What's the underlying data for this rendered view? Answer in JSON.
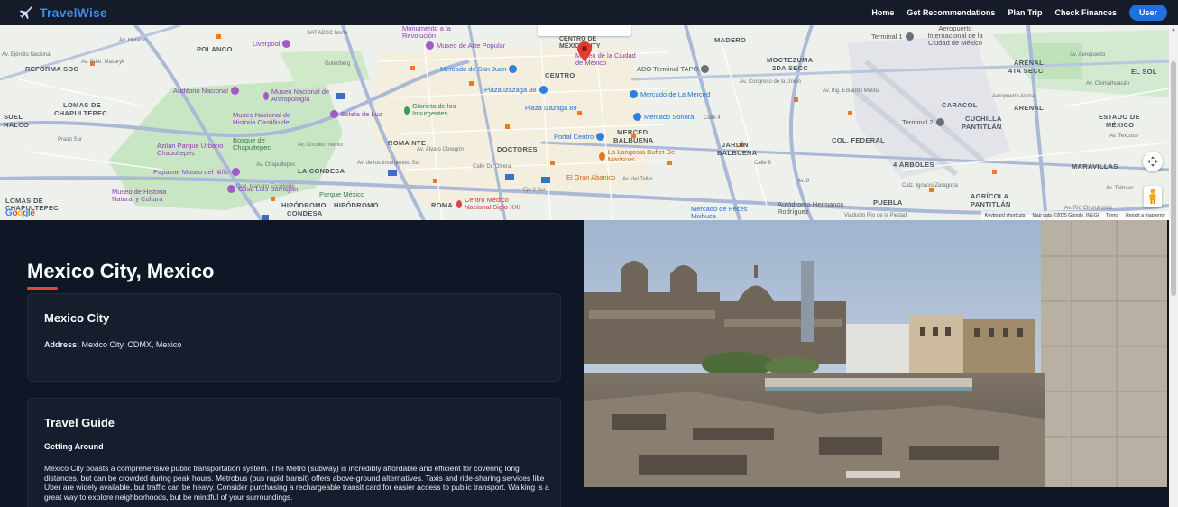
{
  "app": {
    "name": "TravelWise",
    "accent": "#3b8cf5"
  },
  "nav": {
    "links": [
      "Home",
      "Get Recommendations",
      "Plan Trip",
      "Check Finances"
    ],
    "user_label": "User"
  },
  "map": {
    "districts": [
      "POLANCO",
      "REFORMA SOC",
      "LOMAS DE",
      "CHAPULTEPEC",
      "ROMA NTE",
      "DOCTORES",
      "LA CONDESA",
      "HIPÓDROMO",
      "CONDESA",
      "CENTRO",
      "MERCED",
      "BALBUENA",
      "JARDÍN",
      "BALBUENA",
      "MOCTEZUMA",
      "2DA SECC",
      "COL. FEDERAL",
      "CARACOL",
      "CUCHILLA",
      "PANTITLÁN",
      "ESTADO DE",
      "MÉXICO",
      "MARAVILLAS",
      "AGRÍCOLA",
      "PANTITLÁN",
      "ARENAL",
      "4TA SECC",
      "EL SOL",
      "PUEBLA",
      "MADERO",
      "ROMA",
      "HIPÓDROMO",
      "SUEL",
      "HALCO",
      "LOMAS DE",
      "CHAPULTEPEC",
      "4 ÁRBOLES",
      "ARENAL"
    ],
    "pois": {
      "purple": [
        "Museo de Arte Popular",
        "Auditorio Nacional",
        "Museo Nacional de Antropología",
        "Museo Nacional de Historia Castillo de...",
        "Estela de Luz",
        "Papalote Museo del Niño",
        "Casa Luis Barragán",
        "Museo de Historia Natural y Cultura",
        "Museo de la Ciudad de México",
        "Monumento a la Revolución",
        "Liverpool",
        "Azilán Parque Urbano Chapultepec"
      ],
      "blue": [
        "Mercado de San Juan",
        "Plaza Izazaga 38",
        "Plaza Izazaga 89",
        "Mercado de La Merced",
        "Mercado Sonora",
        "Portal Centro",
        "Mercado de Peces Mixhuca"
      ],
      "green": [
        "Glorieta de los Insurgentes",
        "Bosque de Chapultepec",
        "Parque México"
      ],
      "orange": [
        "La Langosta Buffet De Mariscos",
        "El Gran Abanico"
      ],
      "red": [
        "Centro Médico Nacional Siglo XXI"
      ],
      "gray": [
        "ADO Terminal TAPO",
        "Terminal 1",
        "Terminal 2",
        "Aeropuerto Internacional de la Ciudad de México",
        "Autódromo Hermanos Rodríguez",
        "CENTRO DE MÉXICO CITY"
      ]
    },
    "streets": [
      "Av. Horacio",
      "Av. Pdte. Masaryk",
      "Gutenberg",
      "Av. Chapultepec",
      "Calz. Ignacio Zaragoza",
      "Av. Ejército Nacional",
      "Av. Álvaro Obregón",
      "Calle Dr. Olvera",
      "Av. del Taller",
      "Eje 3 Sur",
      "Av. Circuito Interior",
      "Prado Sur",
      "SAT ADSC Norte",
      "Av. Ing. Eduardo Molina",
      "Av. Congreso de la Unión",
      "Viaducto Río de la Piedad",
      "Av. 8",
      "Av. Tláhuac",
      "Av. Río Churubusco",
      "Av. Aeropuerto",
      "Aeropuerto Arenal",
      "Av. Chimalhuacán",
      "Av. Texcoco",
      "Calle 4",
      "Calle 6",
      "Gral. Mariano Escobedo",
      "Av. de los Insurgentes Sur"
    ],
    "footer": [
      "Keyboard shortcuts",
      "Map data ©2025 Google, INEGI",
      "Terms",
      "Report a map error"
    ],
    "logo": "Google"
  },
  "place": {
    "title": "Mexico City, Mexico",
    "name": "Mexico City",
    "address_label": "Address:",
    "address_value": "Mexico City, CDMX, Mexico"
  },
  "guide": {
    "title": "Travel Guide",
    "section": "Getting Around",
    "body": "Mexico City boasts a comprehensive public transportation system. The Metro (subway) is incredibly affordable and efficient for covering long distances, but can be crowded during peak hours. Metrobus (bus rapid transit) offers above-ground alternatives. Taxis and ride-sharing services like Uber are widely available, but traffic can be heavy. Consider purchasing a rechargeable transit card for easier access to public transport. Walking is a great way to explore neighborhoods, but be mindful of your surroundings."
  },
  "colors": {
    "page_bg": "#0f1626",
    "card_bg": "#161e2e",
    "underline": "#e0463b",
    "user_button": "#1f6fe0"
  }
}
